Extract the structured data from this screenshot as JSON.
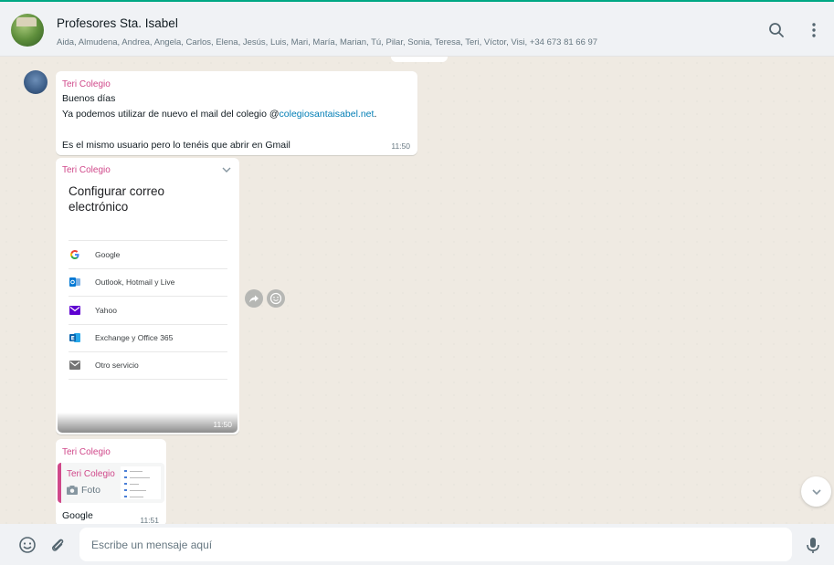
{
  "header": {
    "title": "Profesores Sta. Isabel",
    "members": "Aida, Almudena, Andrea, Angela, Carlos, Elena, Jesús, Luis, Mari, María, Marian, Tú, Pilar, Sonia, Teresa, Teri, Víctor, Visi, +34 673 81 66 97",
    "icons": [
      "search-icon",
      "menu-icon"
    ]
  },
  "messages": [
    {
      "sender": "Teri Colegio",
      "line1": "Buenos días",
      "line2_prefix": "Ya podemos utilizar de nuevo el mail del colegio @",
      "line2_link": "colegiosantaisabel.net",
      "line2_suffix": ".",
      "line3": "Es el mismo usuario pero lo tenéis que abrir en Gmail",
      "time": "11:50"
    },
    {
      "sender": "Teri Colegio",
      "image_title": "Configurar correo electrónico",
      "services": [
        {
          "label": "Google",
          "icon": "google-icon",
          "color": "#4285f4"
        },
        {
          "label": "Outlook, Hotmail y Live",
          "icon": "outlook-icon",
          "color": "#0078d4"
        },
        {
          "label": "Yahoo",
          "icon": "yahoo-icon",
          "color": "#5f01d1"
        },
        {
          "label": "Exchange y Office 365",
          "icon": "exchange-icon",
          "color": "#0a64ad"
        },
        {
          "label": "Otro servicio",
          "icon": "mail-icon",
          "color": "#757575"
        }
      ],
      "time": "11:50"
    },
    {
      "sender": "Teri Colegio",
      "quoted_sender": "Teri Colegio",
      "quoted_type": "Foto",
      "text": "Google",
      "time": "11:51"
    }
  ],
  "composer": {
    "placeholder": "Escribe un mensaje aquí",
    "value": ""
  },
  "colors": {
    "accent": "#00a884",
    "sender_name": "#d0488a",
    "link": "#027eb5",
    "chat_bg": "#efeae2",
    "panel_bg": "#f0f2f5"
  }
}
